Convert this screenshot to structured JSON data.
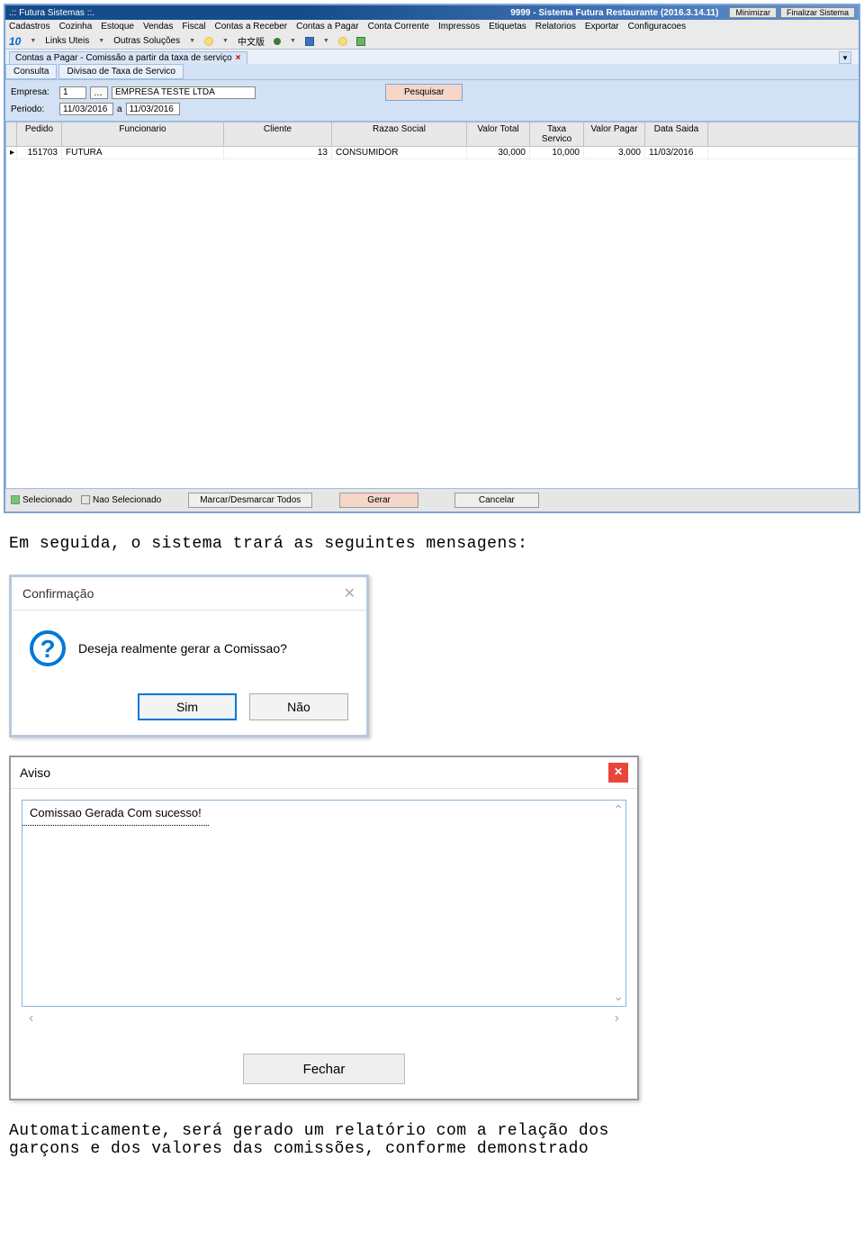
{
  "titlebar": {
    "left": ".:: Futura Sistemas ::.",
    "right": "9999 - Sistema Futura Restaurante (2016.3.14.11)",
    "minimize": "Minimizar",
    "close": "Finalizar Sistema"
  },
  "menu": [
    "Cadastros",
    "Cozinha",
    "Estoque",
    "Vendas",
    "Fiscal",
    "Contas a Receber",
    "Contas a Pagar",
    "Conta Corrente",
    "Impressos",
    "Etiquetas",
    "Relatorios",
    "Exportar",
    "Configuracoes"
  ],
  "toolbar": {
    "ten": "10",
    "links": "Links Uteis",
    "outras": "Outras Soluções",
    "chinese": "中文版"
  },
  "docTab": {
    "title": "Contas a Pagar - Comissão a partir da taxa de serviço"
  },
  "innerTabs": [
    "Consulta",
    "Divisao de Taxa de Servico"
  ],
  "search": {
    "empresa_label": "Empresa:",
    "empresa_code": "1",
    "empresa_name": "EMPRESA TESTE LTDA",
    "periodo_label": "Periodo:",
    "periodo_from": "11/03/2016",
    "periodo_sep": "a",
    "periodo_to": "11/03/2016",
    "button": "Pesquisar"
  },
  "grid": {
    "headers": {
      "pedido": "Pedido",
      "funcionario": "Funcionario",
      "cliente": "Cliente",
      "razao": "Razao Social",
      "valor": "Valor Total",
      "taxa": "Taxa Servico",
      "pagar": "Valor Pagar",
      "data": "Data Saida"
    },
    "rows": [
      {
        "pedido": "151703",
        "funcionario": "FUTURA",
        "cliente": "13",
        "razao": "CONSUMIDOR",
        "valor": "30,000",
        "taxa": "10,000",
        "pagar": "3,000",
        "data": "11/03/2016"
      }
    ]
  },
  "footer": {
    "selecionado": "Selecionado",
    "nao_selecionado": "Nao Selecionado",
    "marcar": "Marcar/Desmarcar Todos",
    "gerar": "Gerar",
    "cancelar": "Cancelar"
  },
  "text1": "Em seguida, o sistema trará as seguintes mensagens:",
  "confirm": {
    "title": "Confirmação",
    "msg": "Deseja realmente gerar a Comissao?",
    "yes": "Sim",
    "no": "Não"
  },
  "aviso": {
    "title": "Aviso",
    "msg": "Comissao Gerada Com sucesso!",
    "close": "Fechar"
  },
  "text2a": "Automaticamente, será gerado um relatório com a relação dos",
  "text2b": "garçons e dos valores das comissões, conforme demonstrado"
}
